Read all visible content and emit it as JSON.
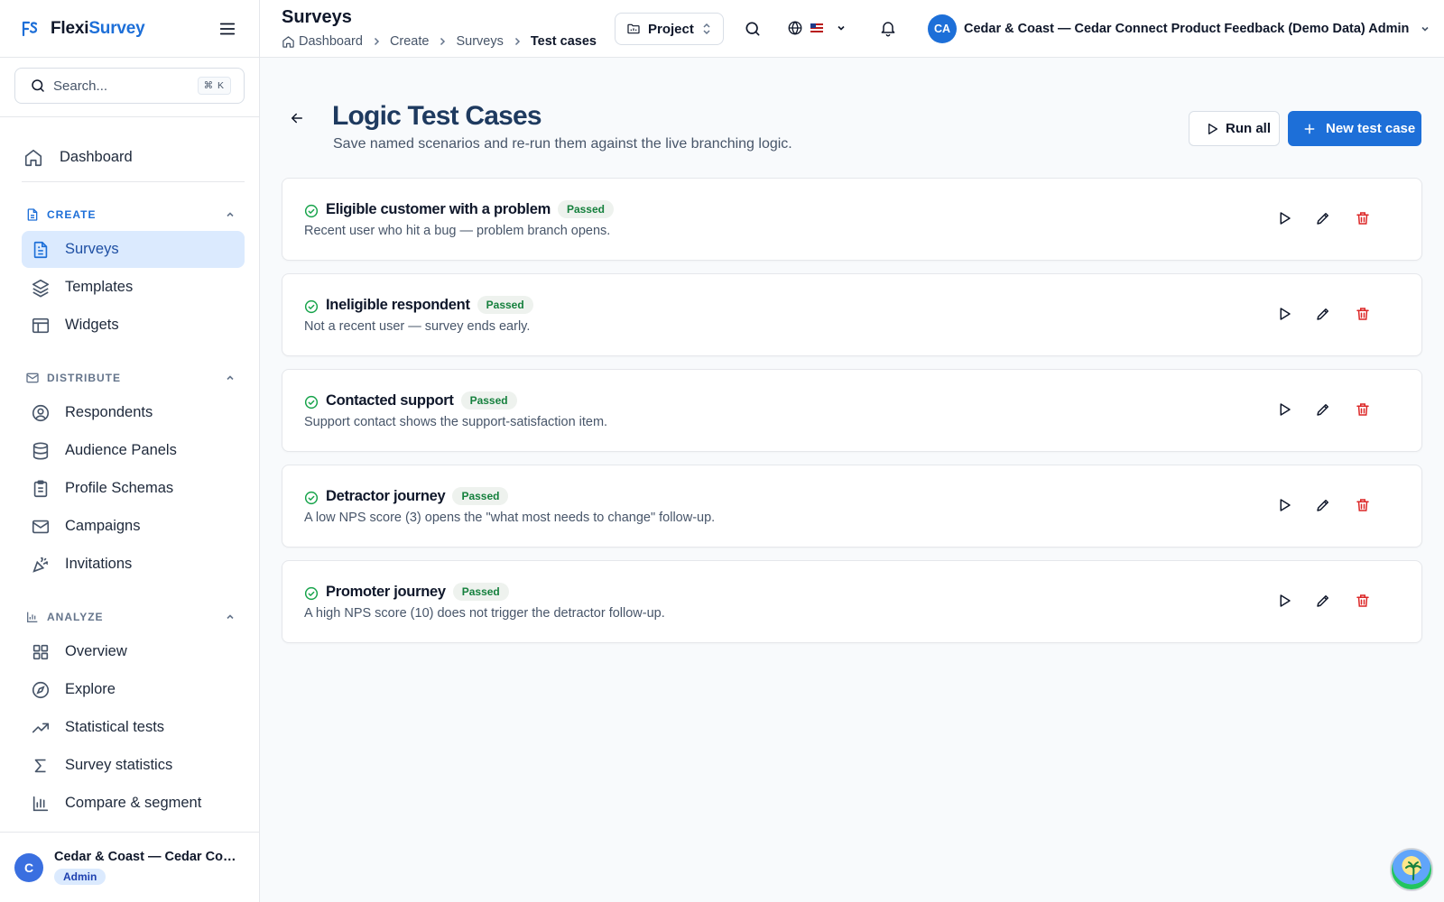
{
  "brand": {
    "name_part1": "Flexi",
    "name_part2": "Survey"
  },
  "sidebar": {
    "search": {
      "placeholder": "Search...",
      "shortcut": "⌘ K"
    },
    "dashboard_label": "Dashboard",
    "sections": [
      {
        "label": "CREATE",
        "items": [
          {
            "label": "Surveys",
            "icon": "file-text-icon",
            "active": true
          },
          {
            "label": "Templates",
            "icon": "layers-icon"
          },
          {
            "label": "Widgets",
            "icon": "layout-icon"
          }
        ]
      },
      {
        "label": "DISTRIBUTE",
        "items": [
          {
            "label": "Respondents",
            "icon": "user-circle-icon"
          },
          {
            "label": "Audience Panels",
            "icon": "database-icon"
          },
          {
            "label": "Profile Schemas",
            "icon": "clipboard-list-icon"
          },
          {
            "label": "Campaigns",
            "icon": "mail-icon"
          },
          {
            "label": "Invitations",
            "icon": "party-popper-icon"
          }
        ]
      },
      {
        "label": "ANALYZE",
        "items": [
          {
            "label": "Overview",
            "icon": "grid-icon"
          },
          {
            "label": "Explore",
            "icon": "compass-icon"
          },
          {
            "label": "Statistical tests",
            "icon": "trending-up-icon"
          },
          {
            "label": "Survey statistics",
            "icon": "sigma-icon"
          },
          {
            "label": "Compare & segment",
            "icon": "bar-chart-icon"
          }
        ]
      }
    ],
    "footer": {
      "avatar_initial": "C",
      "org_name": "Cedar & Coast — Cedar Connect Product Feedback (Demo Data) Admin",
      "role": "Admin"
    }
  },
  "header": {
    "title": "Surveys",
    "breadcrumb": [
      "Dashboard",
      "Create",
      "Surveys",
      "Test cases"
    ],
    "project_label": "Project",
    "user": {
      "initials": "CA",
      "name": "Cedar & Coast — Cedar Connect Product Feedback (Demo Data) Admin"
    }
  },
  "main": {
    "title": "Logic Test Cases",
    "subtitle": "Save named scenarios and re-run them against the live branching logic.",
    "run_all_label": "Run all",
    "new_test_label": "New test case",
    "test_cases": [
      {
        "name": "Eligible customer with a problem",
        "status": "Passed",
        "description": "Recent user who hit a bug — problem branch opens."
      },
      {
        "name": "Ineligible respondent",
        "status": "Passed",
        "description": "Not a recent user — survey ends early."
      },
      {
        "name": "Contacted support",
        "status": "Passed",
        "description": "Support contact shows the support-satisfaction item."
      },
      {
        "name": "Detractor journey",
        "status": "Passed",
        "description": "A low NPS score (3) opens the \"what most needs to change\" follow-up."
      },
      {
        "name": "Promoter journey",
        "status": "Passed",
        "description": "A high NPS score (10) does not trigger the detractor follow-up."
      }
    ]
  },
  "colors": {
    "accent": "#1d6fd8",
    "passed": "#16a34a",
    "delete": "#dc2626",
    "active_bg": "#dbeafe"
  }
}
